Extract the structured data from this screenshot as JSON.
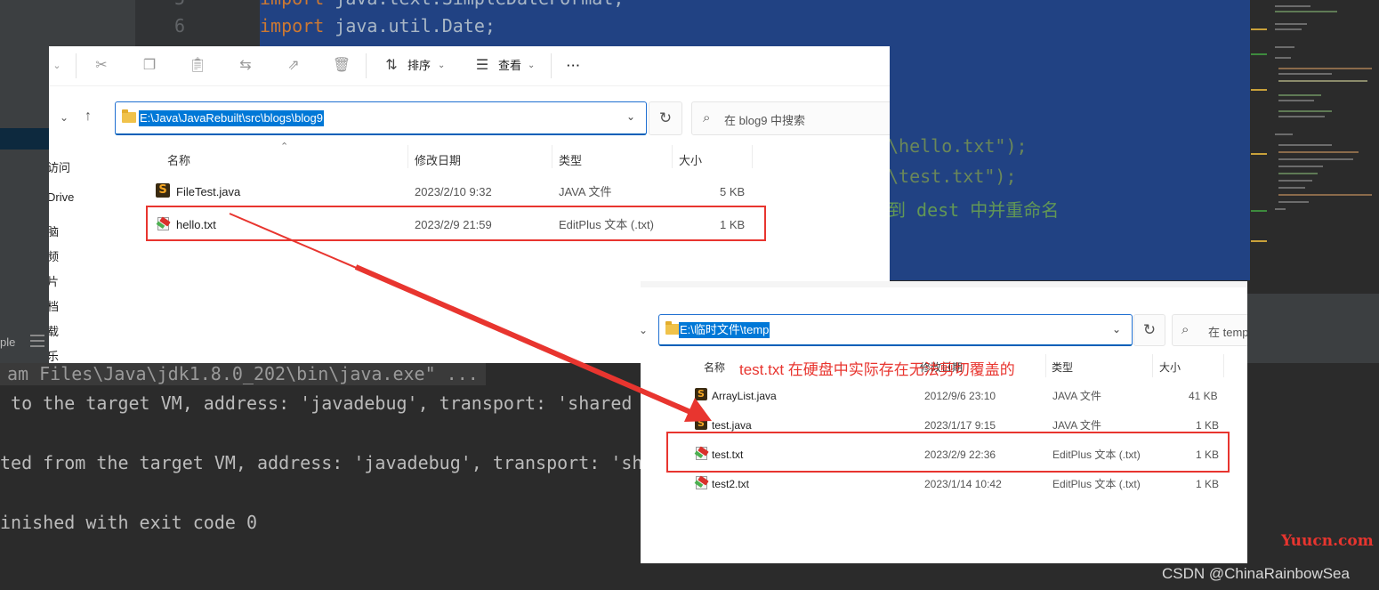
{
  "ide": {
    "line_numbers": [
      "5",
      "6"
    ],
    "code_line_top": {
      "kw": "import",
      "rest": "java.text.SimpleDateFormat;"
    },
    "code_line_6": {
      "kw": "import",
      "rest": "java.util.Date;"
    },
    "code_frag_1": {
      "pre": "\\",
      "str": "hello.txt\");"
    },
    "code_frag_2": {
      "pre": "\\",
      "str": "test.txt\");"
    },
    "code_frag_3": "到 dest 中并重命名",
    "run_tab_label": "ple",
    "console": {
      "cmd": "am Files\\Java\\jdk1.8.0_202\\bin\\java.exe\" ...",
      "line_connected": " to the target VM, address: 'javadebug', transport: 'shared m",
      "line_disconnected": "ted from the target VM, address: 'javadebug', transport: 'sha",
      "line_exit": "inished with exit code 0"
    }
  },
  "explorer1": {
    "toolbar": {
      "sort_label": "排序",
      "view_label": "查看",
      "more_label": "···"
    },
    "address": "E:\\Java\\JavaRebuilt\\src\\blogs\\blog9",
    "search_placeholder": "在 blog9 中搜索",
    "sidebar": [
      "访问",
      "Drive",
      "脑",
      "频",
      "片",
      "档",
      "载",
      "乐"
    ],
    "columns": {
      "name": "名称",
      "modified": "修改日期",
      "type": "类型",
      "size": "大小"
    },
    "files": [
      {
        "name": "FileTest.java",
        "modified": "2023/2/10 9:32",
        "type": "JAVA 文件",
        "size": "5 KB",
        "icon": "java-file-icon"
      },
      {
        "name": "hello.txt",
        "modified": "2023/2/9 21:59",
        "type": "EditPlus 文本 (.txt)",
        "size": "1 KB",
        "icon": "txt-file-icon"
      }
    ]
  },
  "explorer2": {
    "address": "E:\\临时文件\\temp",
    "search_placeholder": "在 temp",
    "columns": {
      "name": "名称",
      "modified": "修改日期",
      "type": "类型",
      "size": "大小"
    },
    "files": [
      {
        "name": "ArrayList.java",
        "modified": "2012/9/6 23:10",
        "type": "JAVA 文件",
        "size": "41 KB",
        "icon": "java-file-icon"
      },
      {
        "name": "test.java",
        "modified": "2023/1/17 9:15",
        "type": "JAVA 文件",
        "size": "1 KB",
        "icon": "java-file-icon"
      },
      {
        "name": "test.txt",
        "modified": "2023/2/9 22:36",
        "type": "EditPlus 文本 (.txt)",
        "size": "1 KB",
        "icon": "txt-file-icon"
      },
      {
        "name": "test2.txt",
        "modified": "2023/1/14 10:42",
        "type": "EditPlus 文本 (.txt)",
        "size": "1 KB",
        "icon": "txt-file-icon"
      }
    ]
  },
  "annotation": "test.txt 在硬盘中实际存在无法剪切覆盖的",
  "watermarks": {
    "site": "Yuucn.com",
    "csdn": "CSDN @ChinaRainbowSea"
  },
  "colors": {
    "annotation_red": "#e8352f",
    "selection_blue": "#0078d7",
    "ide_selection": "#214283"
  }
}
